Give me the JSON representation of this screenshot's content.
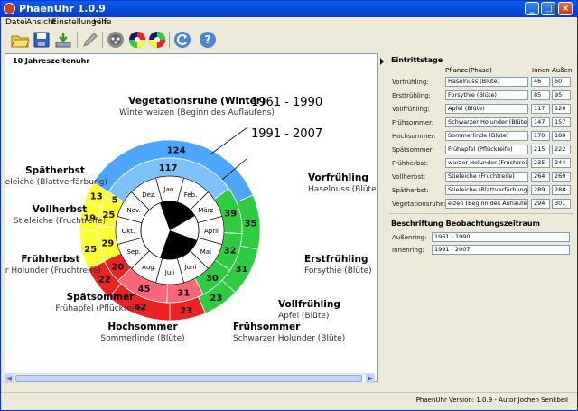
{
  "window": {
    "title": "PhaenUhr 1.0.9"
  },
  "menu": [
    "Datei",
    "Ansicht",
    "Einstellungen",
    "Hilfe"
  ],
  "toolbar_icons": [
    "open-folder-icon",
    "save-icon",
    "import-icon",
    "edit-pencil-icon",
    "settings-icon",
    "color-wheel-icon",
    "color-wheel-alt-icon",
    "refresh-icon",
    "help-icon"
  ],
  "left_panel": {
    "title": "10 Jahreszeitenuhr"
  },
  "colors": {
    "outer_blue": "#4da6ff",
    "inner_blue": "#7dc1ff",
    "green": "#2ecc40",
    "yellow": "#ffff33",
    "red": "#ee2222",
    "pink": "#ff6677"
  },
  "clock": {
    "legend_outer": "1961 - 1990",
    "legend_inner": "1991 - 2007",
    "months": [
      "Jan.",
      "Feb.",
      "März",
      "April",
      "Mai",
      "Juni",
      "Juli",
      "Aug.",
      "Sep.",
      "Okt.",
      "Nov.",
      "Dez."
    ],
    "outer_ring": [
      {
        "season": "Vegetationsruhe (Winter)",
        "day": 124
      },
      {
        "season": "Vorfrühling",
        "day": 35
      },
      {
        "season": "Erstfrühling",
        "day": 31
      },
      {
        "season": "Vollfrühling",
        "day": 23
      },
      {
        "season": "Frühsommer",
        "day": 23
      },
      {
        "season": "Hochsommer",
        "day": 42
      },
      {
        "season": "Spätsommer",
        "day": 22
      },
      {
        "season": "Frühherbst",
        "day": 25
      },
      {
        "season": "Vollherbst",
        "day": 19
      },
      {
        "season": "Spätherbst",
        "day": 13
      }
    ],
    "inner_ring": [
      {
        "season": "Vegetationsruhe (Winter)",
        "day": 117
      },
      {
        "season": "Vorfrühling",
        "day": 39
      },
      {
        "season": "Erstfrühling",
        "day": 32
      },
      {
        "season": "Vollfrühling",
        "day": 30
      },
      {
        "season": "Frühsommer",
        "day": 31
      },
      {
        "season": "Hochsommer",
        "day": 45
      },
      {
        "season": "Spätsommer",
        "day": 20
      },
      {
        "season": "Frühherbst",
        "day": 29
      },
      {
        "season": "Vollherbst",
        "day": 25
      },
      {
        "season": "Spätherbst",
        "day": 5
      }
    ],
    "labels": [
      {
        "title": "Vegetationsruhe (Winter)",
        "sub": "Winterweizen (Beginn des Auflaufens)"
      },
      {
        "title": "Vorfrühling",
        "sub": "Haselnuss (Blüte)"
      },
      {
        "title": "Erstfrühling",
        "sub": "Forsythie (Blüte)"
      },
      {
        "title": "Vollfrühling",
        "sub": "Apfel (Blüte)"
      },
      {
        "title": "Frühsommer",
        "sub": "Schwarzer Holunder (Blüte)"
      },
      {
        "title": "Hochsommer",
        "sub": "Sommerlinde (Blüte)"
      },
      {
        "title": "Spätsommer",
        "sub": "Frühapfel (Pflückreife)"
      },
      {
        "title": "Frühherbst",
        "sub": "er Holunder (Fruchtreife)"
      },
      {
        "title": "Vollherbst",
        "sub": "Stieleiche (Fruchtreife)"
      },
      {
        "title": "Spätherbst",
        "sub": "ieleiche (Blattverfärbung)"
      }
    ]
  },
  "entry_days": {
    "title": "Eintrittstage",
    "col_plant": "Pflanze(Phase)",
    "col_inner": "Innen",
    "col_outer": "Außen",
    "rows": [
      {
        "label": "Vorfrühling:",
        "plant": "Haselnuss (Blüte)",
        "inner": "46",
        "outer": "60"
      },
      {
        "label": "Erstfrühling:",
        "plant": "Forsythie (Blüte)",
        "inner": "85",
        "outer": "95"
      },
      {
        "label": "Vollfrühling:",
        "plant": "Apfel (Blüte)",
        "inner": "117",
        "outer": "126"
      },
      {
        "label": "Frühsommer:",
        "plant": "Schwarzer Holunder (Blüte)",
        "inner": "147",
        "outer": "157"
      },
      {
        "label": "Hochsommer:",
        "plant": "Sommerlinde (Blüte)",
        "inner": "170",
        "outer": "180"
      },
      {
        "label": "Spätsommer:",
        "plant": "Frühapfel (Pflückreife)",
        "inner": "215",
        "outer": "222"
      },
      {
        "label": "Frühherbst:",
        "plant": "warzer Holunder (Fruchtreife)",
        "inner": "235",
        "outer": "244"
      },
      {
        "label": "Vollherbst:",
        "plant": "Stieleiche (Fruchtreife)",
        "inner": "264",
        "outer": "269"
      },
      {
        "label": "Spätherbst:",
        "plant": "Stieleiche (Blattverfärbung)",
        "inner": "289",
        "outer": "288"
      },
      {
        "label": "Vegetationsruhe:",
        "plant": "eizen (Beginn des Auflaufens)",
        "inner": "294",
        "outer": "301"
      }
    ]
  },
  "observation": {
    "title": "Beschriftung Beobachtungszeitraum",
    "outer_label": "Außenring:",
    "outer_value": "1961 - 1990",
    "inner_label": "Innenring:",
    "inner_value": "1991 - 2007"
  },
  "status": {
    "text": "PhaenUhr Version: 1.0.9 - Autor Jochen Senkbeil"
  }
}
